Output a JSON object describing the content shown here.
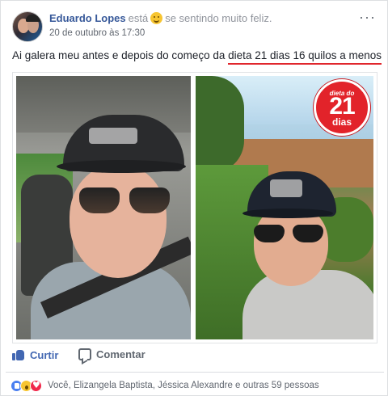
{
  "post": {
    "author": "Eduardo Lopes",
    "is_label": "está",
    "feeling": "se sentindo muito feliz.",
    "timestamp": "20 de outubro às 17:30",
    "more_label": "···",
    "text_before": "Ai galera meu antes e depois do começo da ",
    "text_highlight": "dieta 21 dias 16 quilos a menos"
  },
  "photo_badge": {
    "line1": "dieta do",
    "line2": "21",
    "line3": "dias"
  },
  "actions": {
    "like_label": "Curtir",
    "comment_label": "Comentar"
  },
  "reactions": {
    "summary": "Você, Elizangela Baptista, Jéssica Alexandre e outras 59 pessoas",
    "types": [
      "like",
      "wow",
      "love"
    ]
  },
  "colors": {
    "link": "#365899",
    "like_blue": "#4267b2",
    "highlight_red": "#e0262c"
  }
}
